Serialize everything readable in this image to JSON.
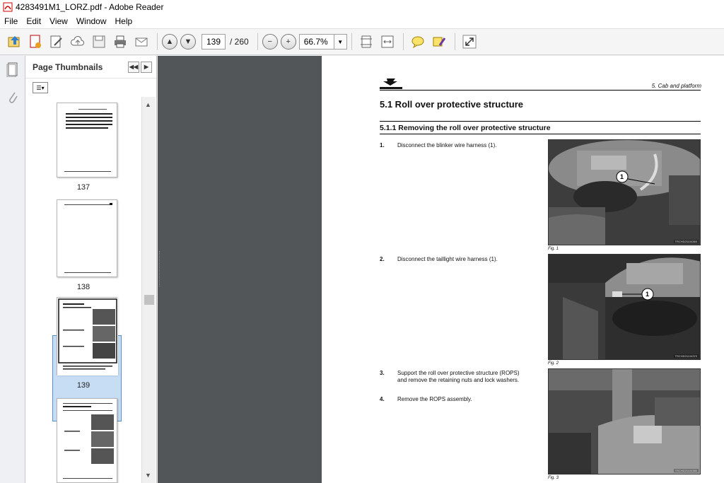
{
  "window": {
    "title": "4283491M1_LORZ.pdf - Adobe Reader"
  },
  "menu": [
    "File",
    "Edit",
    "View",
    "Window",
    "Help"
  ],
  "toolbar": {
    "page_current": "139",
    "page_total": "/ 260",
    "zoom": "66.7%"
  },
  "panel": {
    "title": "Page Thumbnails",
    "thumbnails": [
      {
        "label": "137"
      },
      {
        "label": "138"
      },
      {
        "label": "139",
        "selected": true
      },
      {
        "label": ""
      }
    ]
  },
  "document": {
    "header_right": "5. Cab and platform",
    "section_title": "5.1   Roll over protective structure",
    "subsection_title": "5.1.1  Removing the roll over protective structure",
    "steps": [
      {
        "num": "1.",
        "text": "Disconnect the blinker wire harness (1)."
      },
      {
        "num": "2.",
        "text": "Disconnect the taillight wire harness (1)."
      },
      {
        "num": "3.",
        "text": "Support the roll over protective structure (ROPS) and remove the retaining nuts and lock washers."
      },
      {
        "num": "4.",
        "text": "Remove the ROPS assembly."
      }
    ],
    "figures": [
      {
        "caption": "Fig. 1",
        "callout": "1",
        "id": "TRCHD21104360"
      },
      {
        "caption": "Fig. 2",
        "callout": "1",
        "id": "TRCHD21104370"
      },
      {
        "caption": "Fig. 3",
        "callout": "",
        "id": "TRCHD21104380"
      }
    ]
  }
}
